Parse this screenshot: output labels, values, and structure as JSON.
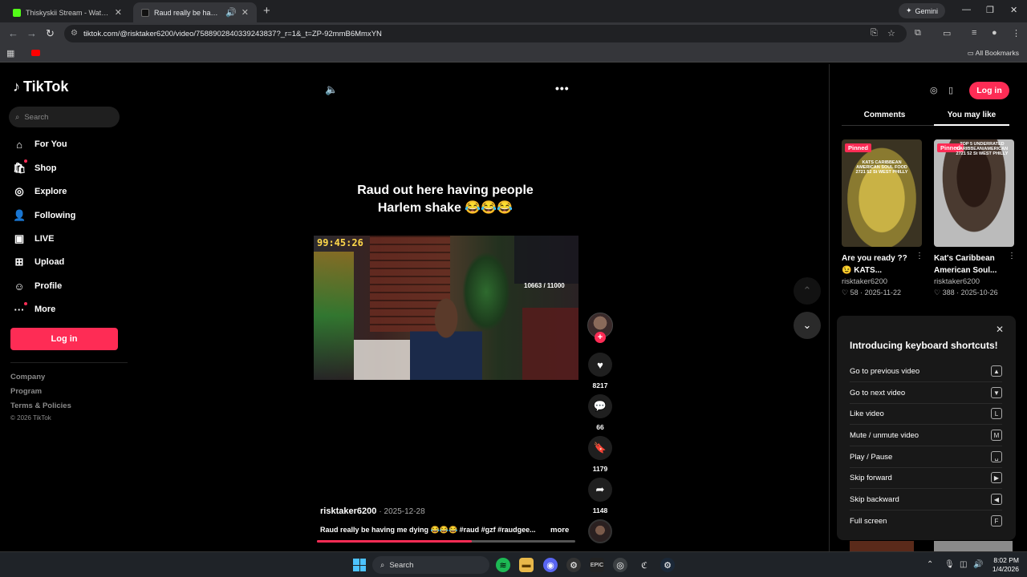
{
  "browser": {
    "tabs": [
      {
        "title": "Thiskyskii Stream - Watch Live o",
        "favicon_color": "#53fc18",
        "active": false
      },
      {
        "title": "Raud really be having me dy",
        "favicon_color": "#ffffff",
        "active": true
      }
    ],
    "gemini_label": "Gemini",
    "url": "tiktok.com/@risktaker6200/video/7588902840339243837?_r=1&_t=ZP-92mmB6MmxYN",
    "bookmarks_all": "All Bookmarks"
  },
  "sidebar": {
    "logo": "TikTok",
    "search_placeholder": "Search",
    "nav": [
      {
        "label": "For You",
        "icon": "home-icon"
      },
      {
        "label": "Shop",
        "icon": "shop-icon"
      },
      {
        "label": "Explore",
        "icon": "compass-icon"
      },
      {
        "label": "Following",
        "icon": "following-icon"
      },
      {
        "label": "LIVE",
        "icon": "live-icon"
      },
      {
        "label": "Upload",
        "icon": "upload-icon"
      },
      {
        "label": "Profile",
        "icon": "profile-icon"
      },
      {
        "label": "More",
        "icon": "more-icon"
      }
    ],
    "login_label": "Log in",
    "footer": [
      "Company",
      "Program",
      "Terms & Policies"
    ],
    "copyright": "© 2026 TikTok"
  },
  "video": {
    "caption_overlay_line1": "Raud out here having people",
    "caption_overlay_line2": "Harlem shake 😂😂😂",
    "stream_timer": "99:45:26",
    "stream_counter": "10663 / 11000",
    "author": "risktaker6200",
    "date": "2025-12-28",
    "description": "Raud really be having me dying 😂😂😂 #raud #gzf #raudgee...",
    "more_label": "more",
    "progress_fraction": 0.6
  },
  "actions": {
    "likes": "8217",
    "comments": "66",
    "saves": "1179",
    "shares": "1148"
  },
  "right_panel": {
    "login_label": "Log in",
    "tabs": [
      "Comments",
      "You may like"
    ],
    "active_tab": "You may like",
    "recommendations": [
      {
        "pinned_label": "Pinned",
        "thumb_text": "KATS CARIBBEAN AMERICAN SOUL FOOD 2721 52 St WEST PHILLY",
        "title": "Are you ready ?? 😉 KATS...",
        "author": "risktaker6200",
        "likes": "58",
        "date": "2025-11-22"
      },
      {
        "pinned_label": "Pinned",
        "thumb_text": "TOP 5 UNDERRATED CARIBBEAN/AMERICAN 2721 52 St WEST PHILLY",
        "title": "Kat's Caribbean American Soul...",
        "author": "risktaker6200",
        "likes": "388",
        "date": "2025-10-26"
      }
    ]
  },
  "shortcuts": {
    "title": "Introducing keyboard shortcuts!",
    "items": [
      {
        "label": "Go to previous video",
        "key": "▲"
      },
      {
        "label": "Go to next video",
        "key": "▼"
      },
      {
        "label": "Like video",
        "key": "L"
      },
      {
        "label": "Mute / unmute video",
        "key": "M"
      },
      {
        "label": "Play / Pause",
        "key": "␣"
      },
      {
        "label": "Skip forward",
        "key": "▶"
      },
      {
        "label": "Skip backward",
        "key": "◀"
      },
      {
        "label": "Full screen",
        "key": "F"
      }
    ]
  },
  "taskbar": {
    "search_label": "Search",
    "time": "8:02 PM",
    "date": "1/4/2026"
  },
  "colors": {
    "accent": "#fe2c55",
    "background": "#000000"
  }
}
